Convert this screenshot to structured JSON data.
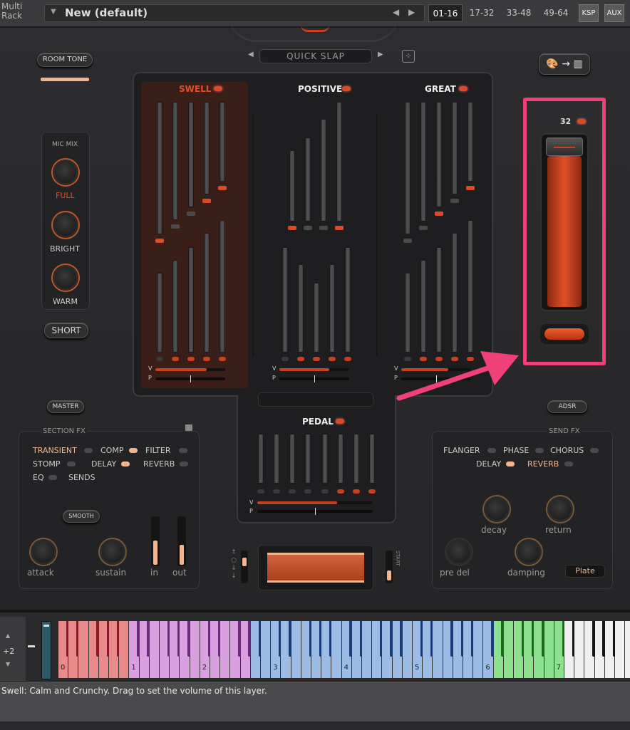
{
  "topbar": {
    "rack_line1": "Multi",
    "rack_line2": "Rack",
    "preset_name": "New (default)",
    "ranges": [
      "01-16",
      "17-32",
      "33-48",
      "49-64"
    ],
    "ksp": "KSP",
    "aux": "AUX"
  },
  "header": {
    "room_tone": "ROOM TONE",
    "quick_slap": "QUICK SLAP"
  },
  "mic_mix": {
    "title": "MIC MIX",
    "knobs": [
      "FULL",
      "BRIGHT",
      "WARM"
    ],
    "short": "SHORT"
  },
  "manuals": {
    "swell": "SWELL",
    "positive": "POSITIVE",
    "great": "GREAT",
    "pedal": "PEDAL",
    "v": "V",
    "p": "P"
  },
  "swell_volume": {
    "value": "32"
  },
  "section_fx": {
    "master": "MASTER",
    "title": "SECTION FX",
    "items": [
      "TRANSIENT",
      "COMP",
      "FILTER",
      "STOMP",
      "DELAY",
      "REVERB",
      "EQ",
      "SENDS"
    ],
    "smooth": "SMOOTH",
    "knobs": [
      "attack",
      "sustain"
    ],
    "faders": [
      "in",
      "out"
    ]
  },
  "send_fx": {
    "adsr": "ADSR",
    "title": "SEND FX",
    "items": [
      "FLANGER",
      "PHASE",
      "CHORUS",
      "DELAY",
      "REVERB"
    ],
    "knobs": [
      "decay",
      "return",
      "pre del",
      "damping"
    ],
    "plate": "Plate"
  },
  "keyboard": {
    "octave_shift": "+2",
    "octaves": [
      "0",
      "1",
      "2",
      "3",
      "4",
      "5",
      "6",
      "7"
    ],
    "start": "START"
  },
  "status": {
    "text": "Swell: Calm and Crunchy. Drag to set the volume of this layer."
  },
  "colors": {
    "accent": "#d84a28",
    "highlight": "#f0407a"
  }
}
